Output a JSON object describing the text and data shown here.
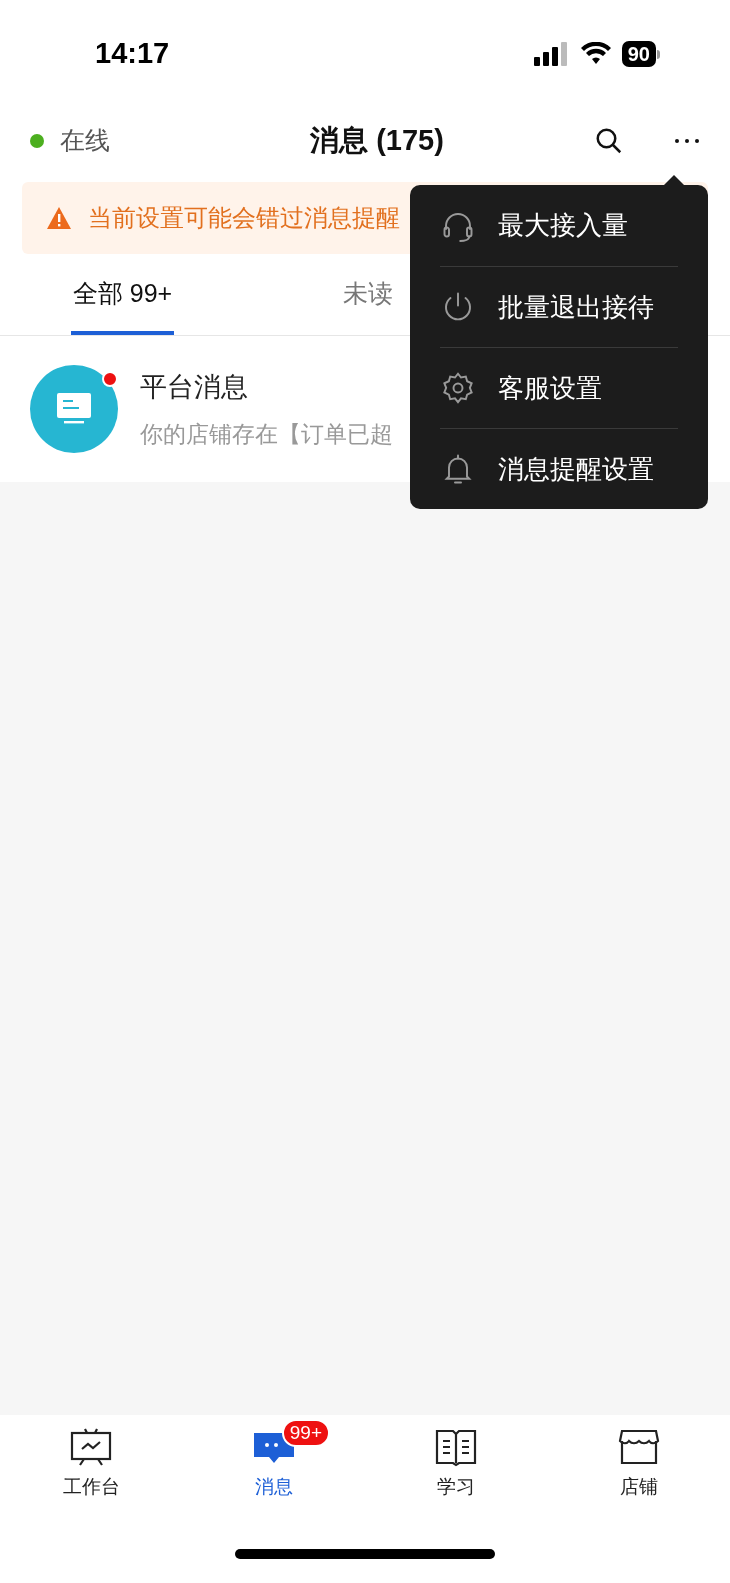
{
  "status_bar": {
    "time": "14:17",
    "battery": "90"
  },
  "header": {
    "presence": "在线",
    "online": true,
    "title": "消息 (175)"
  },
  "banner": {
    "text": "当前设置可能会错过消息提醒"
  },
  "tabs": [
    {
      "label": "全部 99+",
      "selected": true
    },
    {
      "label": "未读",
      "selected": false
    }
  ],
  "conversations": [
    {
      "name": "平台消息",
      "preview": "你的店铺存在【订单已超",
      "unread": true
    }
  ],
  "menu": [
    {
      "kind": "headset",
      "label": "最大接入量"
    },
    {
      "kind": "power",
      "label": "批量退出接待"
    },
    {
      "kind": "gear",
      "label": "客服设置"
    },
    {
      "kind": "bell",
      "label": "消息提醒设置"
    }
  ],
  "bottom_nav": [
    {
      "kind": "board",
      "label": "工作台",
      "selected": false
    },
    {
      "kind": "chat",
      "label": "消息",
      "selected": true,
      "badge": "99+"
    },
    {
      "kind": "book",
      "label": "学习",
      "selected": false
    },
    {
      "kind": "store",
      "label": "店铺",
      "selected": false
    }
  ]
}
